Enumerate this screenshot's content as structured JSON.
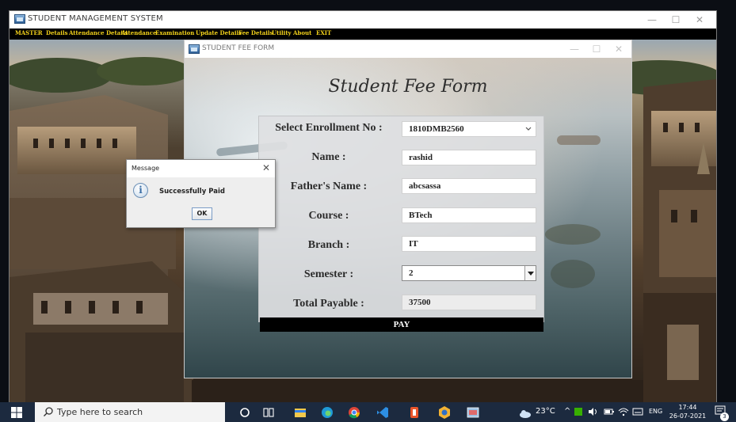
{
  "main_window": {
    "title": "STUDENT MANAGEMENT SYSTEM",
    "controls": {
      "minimize": "—",
      "maximize": "☐",
      "close": "✕"
    }
  },
  "menubar": {
    "items": [
      "MASTER",
      "Details",
      "Attendance Details",
      "Attendance",
      "Examination",
      "Update Details",
      "Fee Details",
      "Utility",
      "About",
      "EXIT"
    ]
  },
  "fee_window": {
    "title": "STUDENT FEE FORM",
    "heading": "Student Fee Form",
    "controls": {
      "minimize": "—",
      "maximize": "☐",
      "close": "✕"
    },
    "form": {
      "enrollment": {
        "label": "Select Enrollment No :",
        "value": "1810DMB2560"
      },
      "name": {
        "label": "Name :",
        "value": "rashid"
      },
      "father_name": {
        "label": "Father's Name :",
        "value": "abcsassa"
      },
      "course": {
        "label": "Course :",
        "value": "BTech"
      },
      "branch": {
        "label": "Branch :",
        "value": "IT"
      },
      "semester": {
        "label": "Semester :",
        "value": "2"
      },
      "total_payable": {
        "label": "Total Payable :",
        "value": "37500"
      }
    },
    "pay_button": "PAY"
  },
  "message_dialog": {
    "title": "Message",
    "close": "✕",
    "icon": "info-icon",
    "text": "Successfully Paid",
    "ok_button": "OK"
  },
  "taskbar": {
    "search_placeholder": "Type here to search",
    "apps": [
      "cortana-icon",
      "task-view-icon",
      "file-explorer-icon",
      "edge-icon",
      "chrome-icon",
      "vscode-icon",
      "office-icon",
      "app-icon",
      "java-app-icon"
    ],
    "temperature": "23°C",
    "language": "ENG",
    "time": "17:44",
    "date": "26-07-2021",
    "notification_count": "3"
  },
  "colors": {
    "menu_text": "#f3d21b",
    "menubar_bg": "#000000",
    "taskbar_bg": "#1c2a3f",
    "pay_button_bg": "#000000"
  }
}
